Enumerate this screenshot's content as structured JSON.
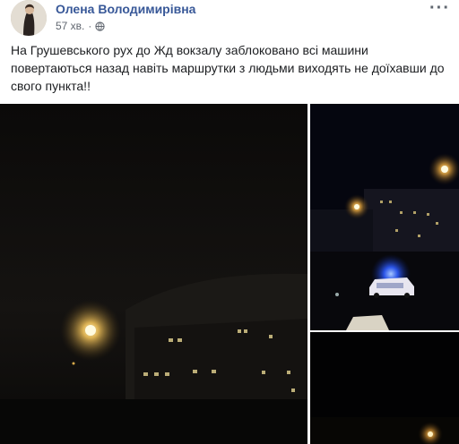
{
  "post": {
    "author": "Олена Володимирівна",
    "timestamp": "57 хв.",
    "separator": "·",
    "privacy_icon": "globe-icon",
    "more_icon": "more-options-icon",
    "more_glyph": "···",
    "text": "На Грушевського рух до Жд вокзалу заблоковано всі машини повертаються назад навіть маршрутки з людьми виходять не доїхавши до свого пункта!!"
  },
  "photos": [
    {
      "icon": "night-street-photo"
    },
    {
      "icon": "police-car-night-photo"
    },
    {
      "icon": "dark-street-lamp-photo"
    }
  ],
  "colors": {
    "author": "#385898",
    "meta": "#616770",
    "text": "#1c1e21"
  }
}
